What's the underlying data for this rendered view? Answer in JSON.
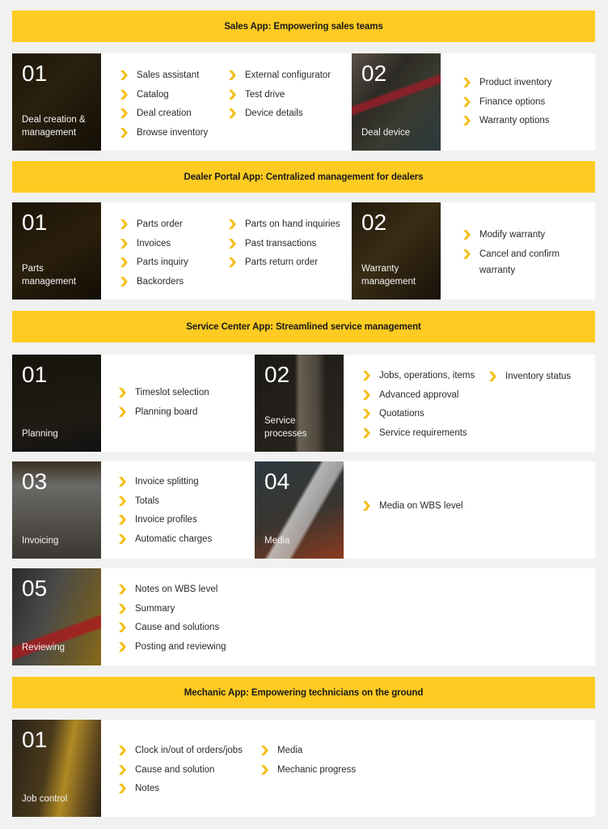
{
  "colors": {
    "accent": "#fecb22",
    "background": "#f1f1f1",
    "card": "#ffffff",
    "chevron": "#f5be1a"
  },
  "sections": [
    {
      "title": "Sales App: Empowering sales teams",
      "rows": [
        {
          "modules": [
            {
              "number": "01",
              "caption": "Deal creation & management",
              "columns": [
                [
                  "Sales assistant",
                  "Catalog",
                  "Deal creation",
                  "Browse inventory"
                ],
                [
                  "External configurator",
                  "Test drive",
                  "Device details"
                ]
              ]
            },
            {
              "number": "02",
              "caption": "Deal device",
              "columns": [
                [
                  "Product inventory",
                  "Finance options",
                  "Warranty options"
                ]
              ]
            }
          ]
        }
      ]
    },
    {
      "title": "Dealer Portal App: Centralized management for dealers",
      "rows": [
        {
          "modules": [
            {
              "number": "01",
              "caption": "Parts management",
              "columns": [
                [
                  "Parts order",
                  "Invoices",
                  "Parts inquiry",
                  "Backorders"
                ],
                [
                  "Parts on hand inquiries",
                  "Past transactions",
                  "Parts return order"
                ]
              ]
            },
            {
              "number": "02",
              "caption": "Warranty management",
              "columns": [
                [
                  "Modify warranty",
                  "Cancel and confirm warranty"
                ]
              ]
            }
          ]
        }
      ]
    },
    {
      "title": "Service Center App: Streamlined service management",
      "rows": [
        {
          "modules": [
            {
              "number": "01",
              "caption": "Planning",
              "columns": [
                [
                  "Timeslot selection",
                  "Planning board"
                ]
              ]
            },
            {
              "number": "02",
              "caption": "Service processes",
              "columns": [
                [
                  "Jobs, operations, items",
                  "Advanced approval",
                  "Quotations",
                  "Service requirements"
                ],
                [
                  "Inventory status"
                ]
              ]
            }
          ]
        },
        {
          "modules": [
            {
              "number": "03",
              "caption": "Invoicing",
              "columns": [
                [
                  "Invoice splitting",
                  "Totals",
                  "Invoice profiles",
                  "Automatic charges"
                ]
              ]
            },
            {
              "number": "04",
              "caption": "Media",
              "columns": [
                [
                  "Media on WBS level"
                ]
              ]
            }
          ]
        },
        {
          "modules": [
            {
              "number": "05",
              "caption": "Reviewing",
              "columns": [
                [
                  "Notes on WBS level",
                  "Summary",
                  "Cause and solutions",
                  "Posting and reviewing"
                ]
              ]
            }
          ]
        }
      ]
    },
    {
      "title": "Mechanic App: Empowering technicians on the ground",
      "rows": [
        {
          "modules": [
            {
              "number": "01",
              "caption": "Job control",
              "columns": [
                [
                  "Clock in/out of orders/jobs",
                  "Cause and solution",
                  "Notes"
                ],
                [
                  "Media",
                  "Mechanic progress"
                ]
              ]
            }
          ]
        }
      ]
    }
  ]
}
